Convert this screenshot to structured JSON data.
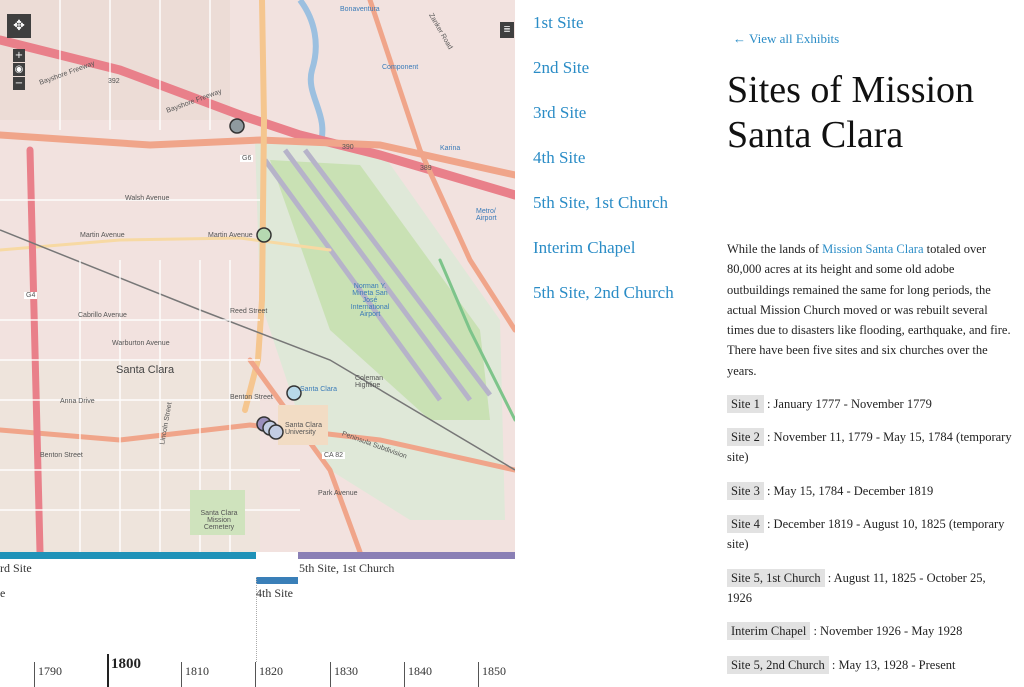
{
  "map": {
    "controls": {
      "pan": "✥",
      "zoom_in": "+",
      "locate": "◉",
      "zoom_out": "−",
      "layers": "≣"
    },
    "labels": {
      "bonaventura": "Bonaventura",
      "zanker_road": "Zanker Road",
      "component": "Component",
      "bayshore_fwy_1": "Bayshore Freeway",
      "bayshore_fwy_2": "Bayshore Freeway",
      "walsh_ave": "Walsh Avenue",
      "martin_ave": "Martin Avenue",
      "martin_ave_2": "Martin Avenue",
      "reed_st": "Reed Street",
      "cabrillo_ave": "Cabrillo Avenue",
      "warburton_ave": "Warburton Avenue",
      "santa_clara": "Santa Clara",
      "anna_drive": "Anna Drive",
      "benton_st": "Benton Street",
      "benton_st_2": "Benton Street",
      "lincoln_st": "Lincoln Street",
      "santa_clara_univ": "Santa Clara University",
      "mission_cemetery": "Santa Clara Mission Cemetery",
      "airport": "Norman Y. Mineta San José International Airport",
      "coleman": "Coleman Highline",
      "park_ave": "Park Avenue",
      "karina": "Karina",
      "metro_airport": "Metro/ Airport",
      "peninsula_sub": "Peninsula Subdivision",
      "ca82": "CA 82",
      "g6": "G6",
      "g4": "G4",
      "santa_clara_station": "Santa Clara",
      "route_390": "390",
      "route_392": "392",
      "route_389": "389"
    }
  },
  "sites": [
    "1st Site",
    "2nd Site",
    "3rd Site",
    "4th Site",
    "5th Site, 1st Church",
    "Interim Chapel",
    "5th Site, 2nd Church"
  ],
  "timeline": {
    "spans": [
      {
        "label": "rd Site",
        "color": "#1f92b8"
      },
      {
        "label": "5th Site, 1st Church",
        "color": "#8a7fb5"
      },
      {
        "label": "4th Site",
        "color": "#3a7fb8"
      }
    ],
    "edge_label": "e",
    "years": [
      "1790",
      "1800",
      "1810",
      "1820",
      "1830",
      "1840",
      "1850"
    ]
  },
  "detail": {
    "back_link": "← View all Exhibits",
    "title": "Sites of Mission Santa Clara",
    "intro_pre": "While the lands of ",
    "intro_link": "Mission Santa Clara",
    "intro_post": " totaled over 80,000 acres at its height and some old adobe outbuildings remained the same for long periods, the actual Mission Church moved or was rebuilt several times due to disasters like flooding, earthquake, and fire. There have been five sites and six churches over the years.",
    "entries": [
      {
        "site": "Site 1",
        "dates": " : January 1777 - November 1779"
      },
      {
        "site": "Site 2",
        "dates": " : November 11, 1779 -  May 15, 1784 (temporary site)"
      },
      {
        "site": "Site 3",
        "dates": " : May 15, 1784 - December 1819"
      },
      {
        "site": "Site 4",
        "dates": " : December 1819 - August 10, 1825 (temporary site)"
      },
      {
        "site": "Site 5, 1st Church",
        "dates": " : August 11, 1825 - October 25, 1926"
      },
      {
        "site": "Interim Chapel",
        "dates": " : November 1926 - May 1928"
      },
      {
        "site": "Site 5, 2nd Church",
        "dates": " : May 13, 1928 - Present"
      }
    ]
  }
}
